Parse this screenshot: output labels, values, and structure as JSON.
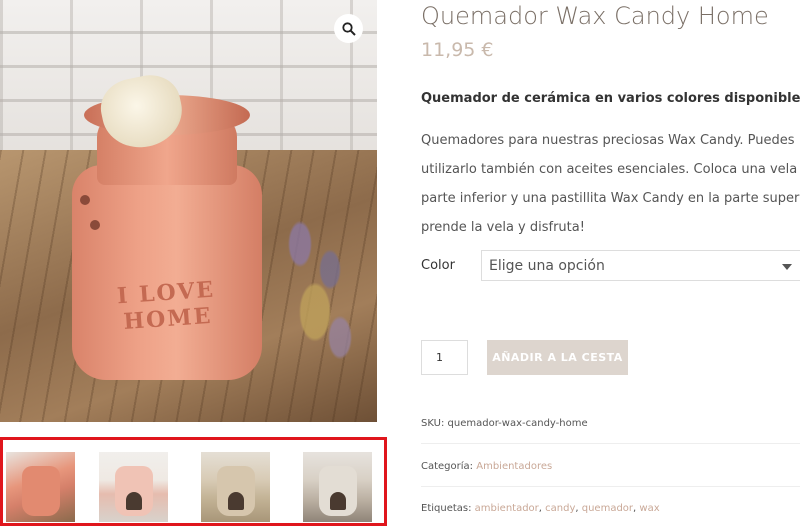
{
  "gallery": {
    "main_image_text": "I LOVE HOME",
    "zoom_icon": "magnifier-icon",
    "thumbnails": [
      {
        "label": "pink burner with wax melt"
      },
      {
        "label": "light pink burner"
      },
      {
        "label": "beige burner"
      },
      {
        "label": "grey burner"
      }
    ],
    "highlight_color": "#e0161c"
  },
  "product": {
    "title": "Quemador Wax Candy Home",
    "price": "11,95 €",
    "short_description": "Quemador de cerámica en varios colores disponibles.",
    "description_lines": [
      "Quemadores para nuestras preciosas Wax Candy.  Puedes",
      "utilizarlo también con aceites esenciales. Coloca una vela en la",
      "parte inferior y una pastillita Wax Candy en la parte superior,",
      "prende la vela y disfruta!"
    ],
    "color_label": "Color",
    "color_select_value": "Elige una opción",
    "quantity": "1",
    "add_to_cart_label": "AÑADIR A  LA CESTA"
  },
  "meta": {
    "sku_label": "SKU:",
    "sku_value": "quemador-wax-candy-home",
    "category_label": "Categoría:",
    "category_value": "Ambientadores",
    "tags_label": "Etiquetas:",
    "tags": [
      "ambientador",
      "candy",
      "quemador",
      "wax"
    ]
  },
  "colors": {
    "title": "#7a6f66",
    "price": "#c9b9ac",
    "button_bg": "#ddd5ce",
    "link": "#c9a897"
  }
}
